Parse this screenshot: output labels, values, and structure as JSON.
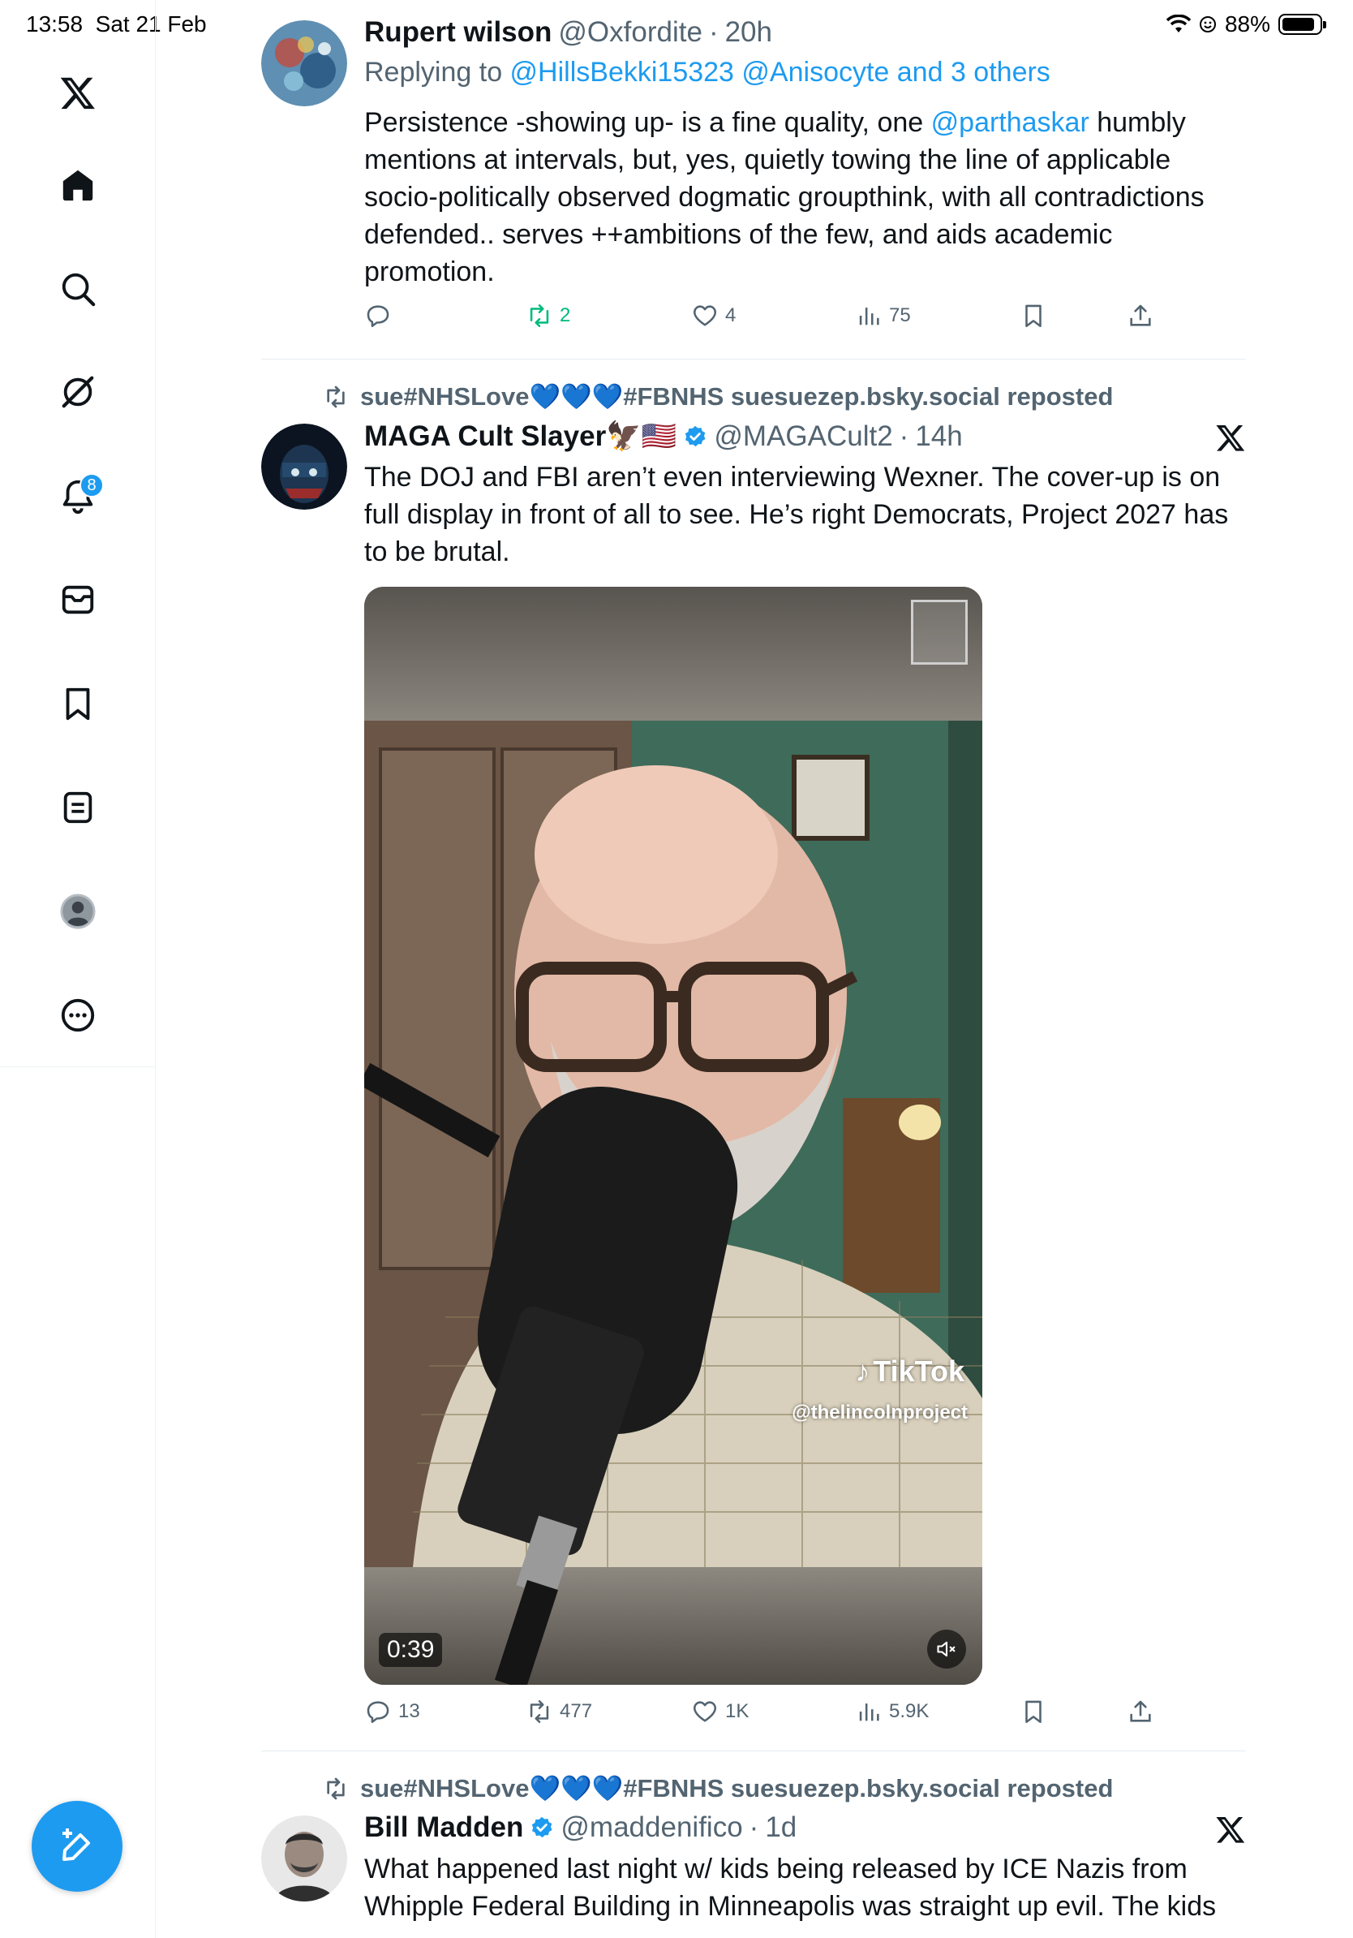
{
  "status_bar": {
    "time": "13:58",
    "date": "Sat 21 Feb",
    "battery": "88%",
    "battery_level": 0.88
  },
  "sidebar": {
    "items": [
      {
        "name": "x-logo-icon"
      },
      {
        "name": "home-icon"
      },
      {
        "name": "search-icon"
      },
      {
        "name": "grok-icon"
      },
      {
        "name": "notifications-icon",
        "badge": "8"
      },
      {
        "name": "messages-icon"
      },
      {
        "name": "bookmarks-icon"
      },
      {
        "name": "lists-icon"
      },
      {
        "name": "profile-icon"
      },
      {
        "name": "more-icon"
      }
    ],
    "compose_icon": "compose-icon"
  },
  "tweets": [
    {
      "name": "Rupert wilson",
      "handle": "@Oxfordite",
      "sep": "·",
      "time": "20h",
      "reply_prefix": "Replying to ",
      "reply_to": "@HillsBekki15323 @Anisocyte and 3 others",
      "text_before": "Persistence -showing up- is a fine quality, one ",
      "mention": "@parthaskar",
      "text_after": " humbly mentions at intervals, but, yes, quietly towing the line of applicable socio-politically observed dogmatic groupthink, with all contradictions defended.. serves ++ambitions of the few, and aids academic promotion.",
      "stats": {
        "replies": "",
        "reposts": "2",
        "likes": "4",
        "views": "75"
      }
    },
    {
      "repost_by": "sue#NHSLove💙💙💙#FBNHS suesuezep.bsky.social reposted",
      "name": "MAGA Cult Slayer🦅🇺🇸",
      "handle": "@MAGACult2",
      "sep": "·",
      "time": "14h",
      "text": "The DOJ and FBI aren’t even interviewing Wexner. The cover-up is on full display in front of all to see. He’s right Democrats, Project 2027 has to be brutal.",
      "video": {
        "duration": "0:39",
        "tiktok_label": "TikTok",
        "tiktok_handle": "@thelincolnproject"
      },
      "stats": {
        "replies": "13",
        "reposts": "477",
        "likes": "1K",
        "views": "5.9K"
      }
    },
    {
      "repost_by": "sue#NHSLove💙💙💙#FBNHS suesuezep.bsky.social reposted",
      "name": "Bill Madden",
      "handle": "@maddenifico",
      "sep": "·",
      "time": "1d",
      "text": "What happened last night w/ kids being released by ICE Nazis from Whipple Federal Building in Minneapolis was straight up evil. The kids"
    }
  ],
  "colors": {
    "accent": "#1d9bf0",
    "muted": "#536471",
    "repost_green": "#00ba7c",
    "text": "#0f1419"
  }
}
